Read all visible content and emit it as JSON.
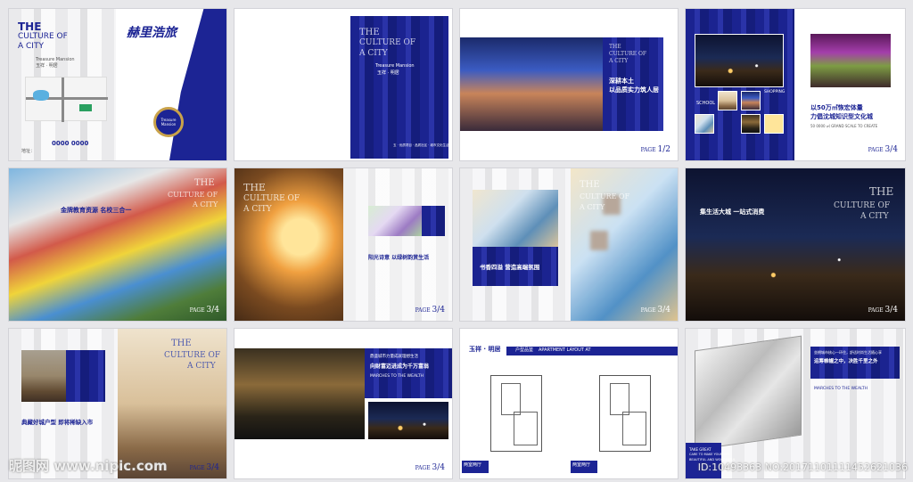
{
  "colors": {
    "brand_navy": "#1c2494",
    "gray": "#d9d9dc",
    "gold": "#c9a24a"
  },
  "p1": {
    "the": "THE",
    "culture": "CULTURE OF",
    "city": "A CITY",
    "sub1": "Treasure Mansion",
    "sub2": "玉祥 · 明居",
    "logo": "赫里浩旅",
    "badge": "Treasure Mansion",
    "hotline": "0000 0000",
    "tiny": "地址："
  },
  "p2": {
    "line1": "THE",
    "line2": "CULTURE OF",
    "line3": "A CITY",
    "sub1": "Treasure Mansion",
    "sub2": "玉祥 · 明居",
    "footer": "玉 · 优质项目 · 品质社区 · 城市文化生活"
  },
  "p3": {
    "line1": "THE",
    "line2": "CULTURE OF",
    "line3": "A CITY",
    "cn1": "深耕本土",
    "cn2": "以品质实力筑人居",
    "page_label": "PAGE",
    "page_num": "1/2"
  },
  "p4": {
    "label_school": "SCHOOL",
    "label_shopping": "SHOPPING",
    "cn1": "以50万㎡恢宏体量",
    "cn2": "力倡沈城知识型文化城",
    "en": "50 0000 ㎡ GRAND SCALE TO CREATE",
    "page_label": "PAGE",
    "page_num": "3/4"
  },
  "p5": {
    "the": "THE",
    "culture": "CULTURE OF",
    "city": "A CITY",
    "cn": "金牌教育资源 名校三合一",
    "page_label": "PAGE",
    "page_num": "3/4"
  },
  "p6": {
    "the": "THE",
    "culture": "CULTURE OF",
    "city": "A CITY",
    "cn": "阳光诗意 以绿树韵赏生活",
    "page_label": "PAGE",
    "page_num": "3/4"
  },
  "p7": {
    "the": "THE",
    "culture": "CULTURE OF",
    "city": "A CITY",
    "cn": "书香四溢 营造高端氛围",
    "page_label": "PAGE",
    "page_num": "3/4"
  },
  "p8": {
    "the": "THE",
    "culture": "CULTURE OF",
    "city": "A CITY",
    "cn": "集生活大城 一站式消费",
    "page_label": "PAGE",
    "page_num": "3/4"
  },
  "p9": {
    "the": "THE",
    "culture": "CULTURE OF",
    "city": "A CITY",
    "cn": "典藏好城户型 即将稀缺入市",
    "page_label": "PAGE",
    "page_num": "3/4"
  },
  "p10": {
    "cn_top": "鼎盛城市力量成就理想生活",
    "cn_main": "向财富迈进成为千万富翁",
    "en": "MARCHES TO THE WEALTH",
    "page_label": "PAGE",
    "page_num": "3/4"
  },
  "p11": {
    "logo": "玉祥 · 明居",
    "section": "户型品鉴",
    "en": "APARTMENT LAYOUT AT",
    "tag1": "两室两厅",
    "tag2": "两室两厅"
  },
  "p12": {
    "cn_top": "坐拥城市核心一环住，舒适时尚生活随心享",
    "cn_main": "运筹帷幄之中，决胜千里之外",
    "en": "MARCHES TO THE WEALTH",
    "slogan1": "TAKE GREAT",
    "slogan2": "CARE TO MAKE YOUR LIFE",
    "slogan3": "BEAUTIFUL AND WONDERFUL"
  },
  "watermark": {
    "site": "昵图网 www.nipic.com",
    "id": "ID:10493363 NO:20171101111452621036"
  }
}
